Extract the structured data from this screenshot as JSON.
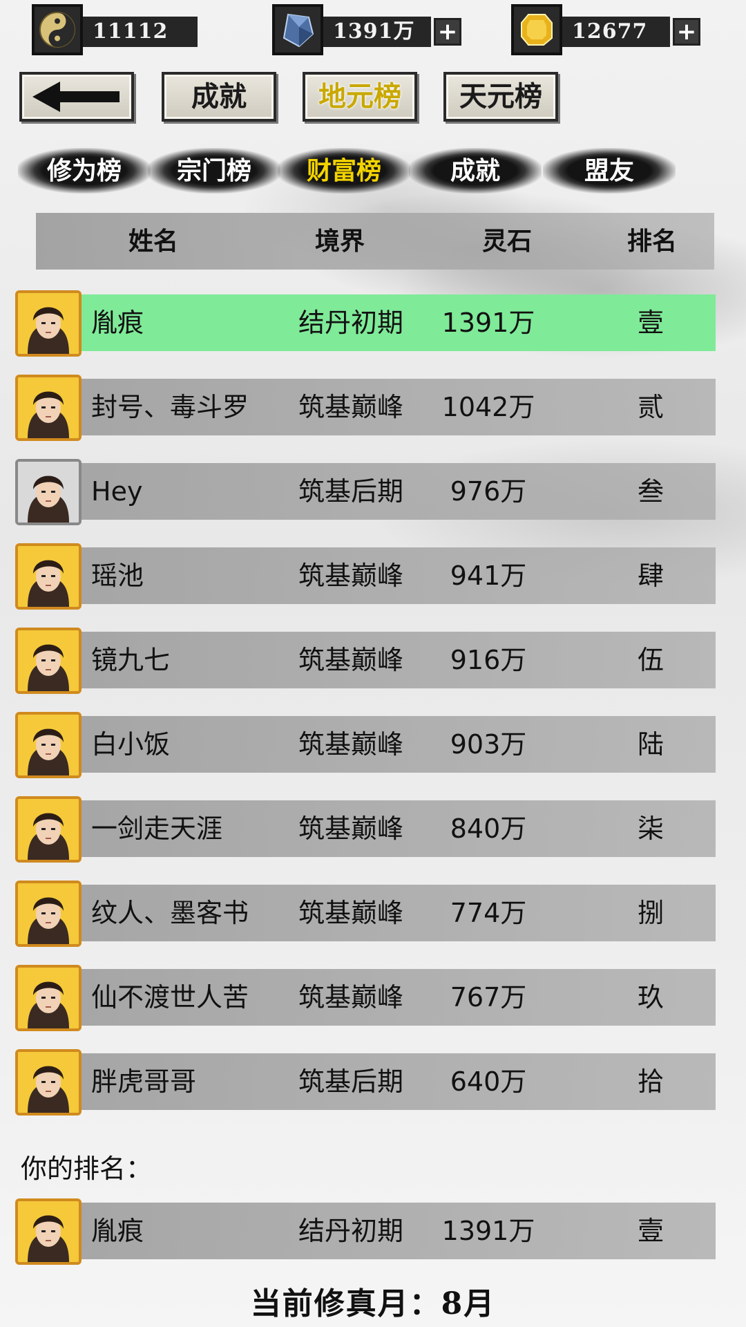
{
  "resources": [
    {
      "icon": "yin-yang-icon",
      "value": "11112",
      "has_plus": false
    },
    {
      "icon": "blue-crystal-icon",
      "value": "1391万",
      "has_plus": true
    },
    {
      "icon": "gold-gem-icon",
      "value": "12677",
      "has_plus": true
    }
  ],
  "plus_label": "+",
  "header": {
    "back_icon": "left-arrow-icon",
    "buttons": [
      {
        "label": "成就",
        "active": false
      },
      {
        "label": "地元榜",
        "active": true
      },
      {
        "label": "天元榜",
        "active": false
      }
    ]
  },
  "tabs": [
    {
      "label": "修为榜",
      "active": false
    },
    {
      "label": "宗门榜",
      "active": false
    },
    {
      "label": "财富榜",
      "active": true
    },
    {
      "label": "成就",
      "active": false
    },
    {
      "label": "盟友",
      "active": false
    }
  ],
  "table": {
    "columns": [
      "姓名",
      "境界",
      "灵石",
      "排名"
    ],
    "rows": [
      {
        "name": "胤痕",
        "realm": "结丹初期",
        "stones": "1391万",
        "rank": "壹",
        "highlight": true
      },
      {
        "name": "封号、毒斗罗",
        "realm": "筑基巅峰",
        "stones": "1042万",
        "rank": "贰"
      },
      {
        "name": "Hey",
        "realm": "筑基后期",
        "stones": "976万",
        "rank": "叁",
        "gray_frame": true
      },
      {
        "name": "瑶池",
        "realm": "筑基巅峰",
        "stones": "941万",
        "rank": "肆"
      },
      {
        "name": "镜九七",
        "realm": "筑基巅峰",
        "stones": "916万",
        "rank": "伍"
      },
      {
        "name": "白小饭",
        "realm": "筑基巅峰",
        "stones": "903万",
        "rank": "陆"
      },
      {
        "name": "一剑走天涯",
        "realm": "筑基巅峰",
        "stones": "840万",
        "rank": "柒"
      },
      {
        "name": "纹人、墨客书",
        "realm": "筑基巅峰",
        "stones": "774万",
        "rank": "捌"
      },
      {
        "name": "仙不渡世人苦",
        "realm": "筑基巅峰",
        "stones": "767万",
        "rank": "玖"
      },
      {
        "name": "胖虎哥哥",
        "realm": "筑基后期",
        "stones": "640万",
        "rank": "拾"
      }
    ]
  },
  "your_rank": {
    "label": "你的排名：",
    "row": {
      "name": "胤痕",
      "realm": "结丹初期",
      "stones": "1391万",
      "rank": "壹"
    }
  },
  "current_month": "当前修真月：8月",
  "colors": {
    "highlight_row": "#7fea98",
    "active_tab": "#f3d400",
    "active_header": "#c9a800",
    "avatar_frame": "#d08a1e"
  }
}
